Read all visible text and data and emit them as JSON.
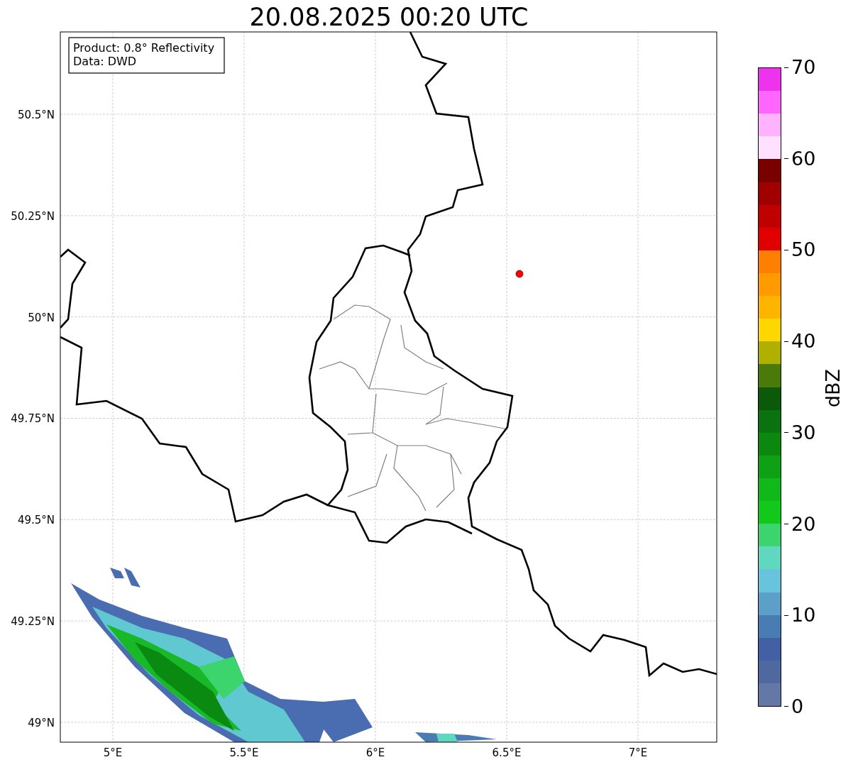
{
  "title": "20.08.2025 00:20 UTC",
  "info_box": {
    "lines": [
      "Product: 0.8° Reflectivity",
      "Data: DWD"
    ]
  },
  "map": {
    "y_ticks": [
      "50.5°N",
      "50.25°N",
      "50°N",
      "49.75°N",
      "49.5°N",
      "49.25°N",
      "49°N"
    ],
    "x_ticks": [
      "5°E",
      "5.5°E",
      "6°E",
      "6.5°E",
      "7°E"
    ]
  },
  "colorbar": {
    "label": "dBZ",
    "ticks": [
      "70",
      "60",
      "50",
      "40",
      "30",
      "20",
      "10",
      "0"
    ],
    "bins": [
      {
        "color": "#ee33ee"
      },
      {
        "color": "#ff66ff"
      },
      {
        "color": "#ffb3ff"
      },
      {
        "color": "#ffe0ff"
      },
      {
        "color": "#7a0000"
      },
      {
        "color": "#a00000"
      },
      {
        "color": "#c00000"
      },
      {
        "color": "#e00000"
      },
      {
        "color": "#ff7f00"
      },
      {
        "color": "#ff9a00"
      },
      {
        "color": "#ffb400"
      },
      {
        "color": "#ffd700"
      },
      {
        "color": "#b0b000"
      },
      {
        "color": "#4a7a0a"
      },
      {
        "color": "#0a5a0a"
      },
      {
        "color": "#0a720f"
      },
      {
        "color": "#0c880f"
      },
      {
        "color": "#0ea015"
      },
      {
        "color": "#10b81a"
      },
      {
        "color": "#12c81a"
      },
      {
        "color": "#3cd46c"
      },
      {
        "color": "#60d8c0"
      },
      {
        "color": "#68c3dc"
      },
      {
        "color": "#5c9fc8"
      },
      {
        "color": "#4a7cb4"
      },
      {
        "color": "#4460a4"
      },
      {
        "color": "#5068a0"
      },
      {
        "color": "#6478a8"
      }
    ]
  }
}
